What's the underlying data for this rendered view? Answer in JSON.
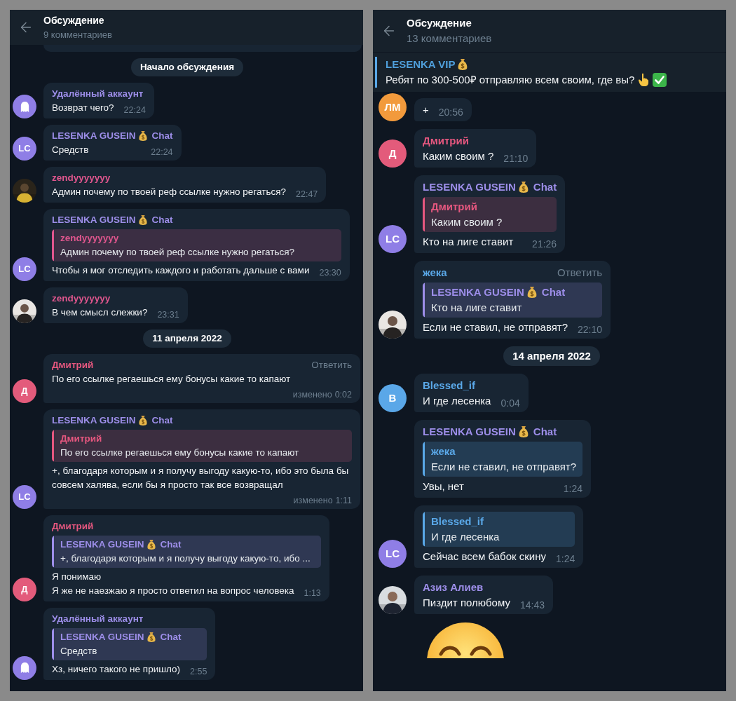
{
  "panels": [
    {
      "header": {
        "title": "Обсуждение",
        "subtitle": "9 комментариев"
      },
      "messages": [
        {
          "kind": "date",
          "text": "Начало обсуждения"
        },
        {
          "kind": "message",
          "author": "Удалённый аккаунт",
          "color": "#9d8ee9",
          "avatar": {
            "kind": "ghost",
            "color": "#8f7ee6"
          },
          "lines": [
            "Возврат чего?"
          ],
          "time": "22:24"
        },
        {
          "kind": "message",
          "author": "LESENKA GUSEIN",
          "money_bag": true,
          "author_tail": "Chat",
          "color": "#9d8ee9",
          "avatar": {
            "kind": "letters",
            "text": "LC",
            "color": "#8f7ee6"
          },
          "lines": [
            "Средств"
          ],
          "time": "22:24"
        },
        {
          "kind": "message",
          "author": "zendyyyyyyy",
          "color": "#e0568e",
          "avatar": {
            "kind": "picture"
          },
          "lines": [
            "Админ почему по твоей реф ссылке нужно регаться?"
          ],
          "time": "22:47"
        },
        {
          "kind": "message",
          "author": "LESENKA GUSEIN",
          "money_bag": true,
          "author_tail": "Chat",
          "color": "#9d8ee9",
          "avatar": {
            "kind": "letters",
            "text": "LC",
            "color": "#8f7ee6"
          },
          "reply": {
            "author": "zendyyyyyyy",
            "color": "#e0568e",
            "text": "Админ почему по твоей реф ссылке нужно регаться?"
          },
          "lines": [
            "Чтобы я мог отследить каждого и работать дальше с вами"
          ],
          "time": "23:30"
        },
        {
          "kind": "message",
          "author": "zendyyyyyyy",
          "color": "#e0568e",
          "avatar": {
            "kind": "picture"
          },
          "lines": [
            "В чем смысл слежки?"
          ],
          "time": "23:31"
        },
        {
          "kind": "date",
          "text": "11 апреля 2022"
        },
        {
          "kind": "message",
          "author": "Дмитрий",
          "color": "#e6577f",
          "reply_link": "Ответить",
          "avatar": {
            "kind": "letters",
            "text": "Д",
            "color": "#e35b7b"
          },
          "lines": [
            "По его ссылке регаешься ему бонусы какие то капают"
          ],
          "edited": "изменено",
          "time": "0:02"
        },
        {
          "kind": "message",
          "author": "LESENKA GUSEIN",
          "money_bag": true,
          "author_tail": "Chat",
          "color": "#9d8ee9",
          "avatar": {
            "kind": "letters",
            "text": "LC",
            "color": "#8f7ee6"
          },
          "reply": {
            "author": "Дмитрий",
            "color": "#e6577f",
            "text": "По его ссылке регаешься ему бонусы какие то капают"
          },
          "lines": [
            "+, благодаря которым и я получу выгоду какую-то, ибо это была бы совсем халява, если бы я просто так все возвращал"
          ],
          "edited": "изменено",
          "time": "1:11"
        },
        {
          "kind": "message",
          "author": "Дмитрий",
          "color": "#e6577f",
          "avatar": {
            "kind": "letters",
            "text": "Д",
            "color": "#e35b7b"
          },
          "reply": {
            "author": "LESENKA GUSEIN",
            "money_bag": true,
            "author_tail": "Chat",
            "color": "#9d8ee9",
            "text": "+, благодаря которым и я получу выгоду какую-то, ибо ..."
          },
          "lines": [
            "Я понимаю",
            "Я же не наезжаю я просто ответил на вопрос человека"
          ],
          "time": "1:13"
        },
        {
          "kind": "message",
          "author": "Удалённый аккаунт",
          "color": "#9d8ee9",
          "avatar": {
            "kind": "ghost",
            "color": "#8f7ee6"
          },
          "reply": {
            "author": "LESENKA GUSEIN",
            "money_bag": true,
            "author_tail": "Chat",
            "color": "#9d8ee9",
            "text": "Средств"
          },
          "lines": [
            "Хз, ничего такого не пришло)"
          ],
          "time": "2:55"
        }
      ]
    },
    {
      "header": {
        "title": "Обсуждение",
        "subtitle": "13 комментариев"
      },
      "pinned": {
        "author": "LESENKA VIP",
        "money_bag": true,
        "text": "Ребят по 300-500₽ отправляю всем своим, где вы?"
      },
      "messages": [
        {
          "kind": "message",
          "avatar": {
            "kind": "letters",
            "text": "ЛМ",
            "color": "#f29a3c"
          },
          "lines": [
            "+"
          ],
          "time": "20:56"
        },
        {
          "kind": "message",
          "author": "Дмитрий",
          "color": "#e6577f",
          "avatar": {
            "kind": "letters",
            "text": "Д",
            "color": "#e35b7b"
          },
          "lines": [
            "Каким своим ?"
          ],
          "time": "21:10"
        },
        {
          "kind": "message",
          "author": "LESENKA GUSEIN",
          "money_bag": true,
          "author_tail": "Chat",
          "color": "#9d8ee9",
          "avatar": {
            "kind": "letters",
            "text": "LC",
            "color": "#8f7ee6"
          },
          "reply": {
            "author": "Дмитрий",
            "color": "#e6577f",
            "text": "Каким своим ?"
          },
          "lines": [
            "Кто на лиге ставит"
          ],
          "time": "21:26"
        },
        {
          "kind": "message",
          "author": "жека",
          "color": "#5aa8e8",
          "reply_link": "Ответить",
          "avatar": {
            "kind": "picture"
          },
          "reply": {
            "author": "LESENKA GUSEIN",
            "money_bag": true,
            "author_tail": "Chat",
            "color": "#9d8ee9",
            "text": "Кто на лиге ставит"
          },
          "lines": [
            "Если не ставил, не отправят?"
          ],
          "time": "22:10"
        },
        {
          "kind": "date",
          "text": "14 апреля 2022"
        },
        {
          "kind": "message",
          "author": "Blessed_if",
          "color": "#5aa8e8",
          "avatar": {
            "kind": "letters",
            "text": "B",
            "color": "#5aa7e8"
          },
          "lines": [
            "И где лесенка"
          ],
          "time": "0:04"
        },
        {
          "kind": "message",
          "author": "LESENKA GUSEIN",
          "money_bag": true,
          "author_tail": "Chat",
          "color": "#9d8ee9",
          "reply": {
            "author": "жека",
            "color": "#5aa8e8",
            "text": "Если не ставил, не отправят?"
          },
          "lines": [
            "Увы, нет"
          ],
          "time": "1:24"
        },
        {
          "kind": "message",
          "avatar": {
            "kind": "letters",
            "text": "LC",
            "color": "#8f7ee6"
          },
          "reply": {
            "author": "Blessed_if",
            "color": "#5aa8e8",
            "text": "И где лесенка"
          },
          "lines": [
            "Сейчас всем бабок скину"
          ],
          "time": "1:24"
        },
        {
          "kind": "message",
          "author": "Азиз Алиев",
          "color": "#9d8ee9",
          "avatar": {
            "kind": "picture"
          },
          "lines": [
            "Пиздит полюбому"
          ],
          "time": "14:43"
        },
        {
          "kind": "emoji"
        }
      ]
    }
  ]
}
